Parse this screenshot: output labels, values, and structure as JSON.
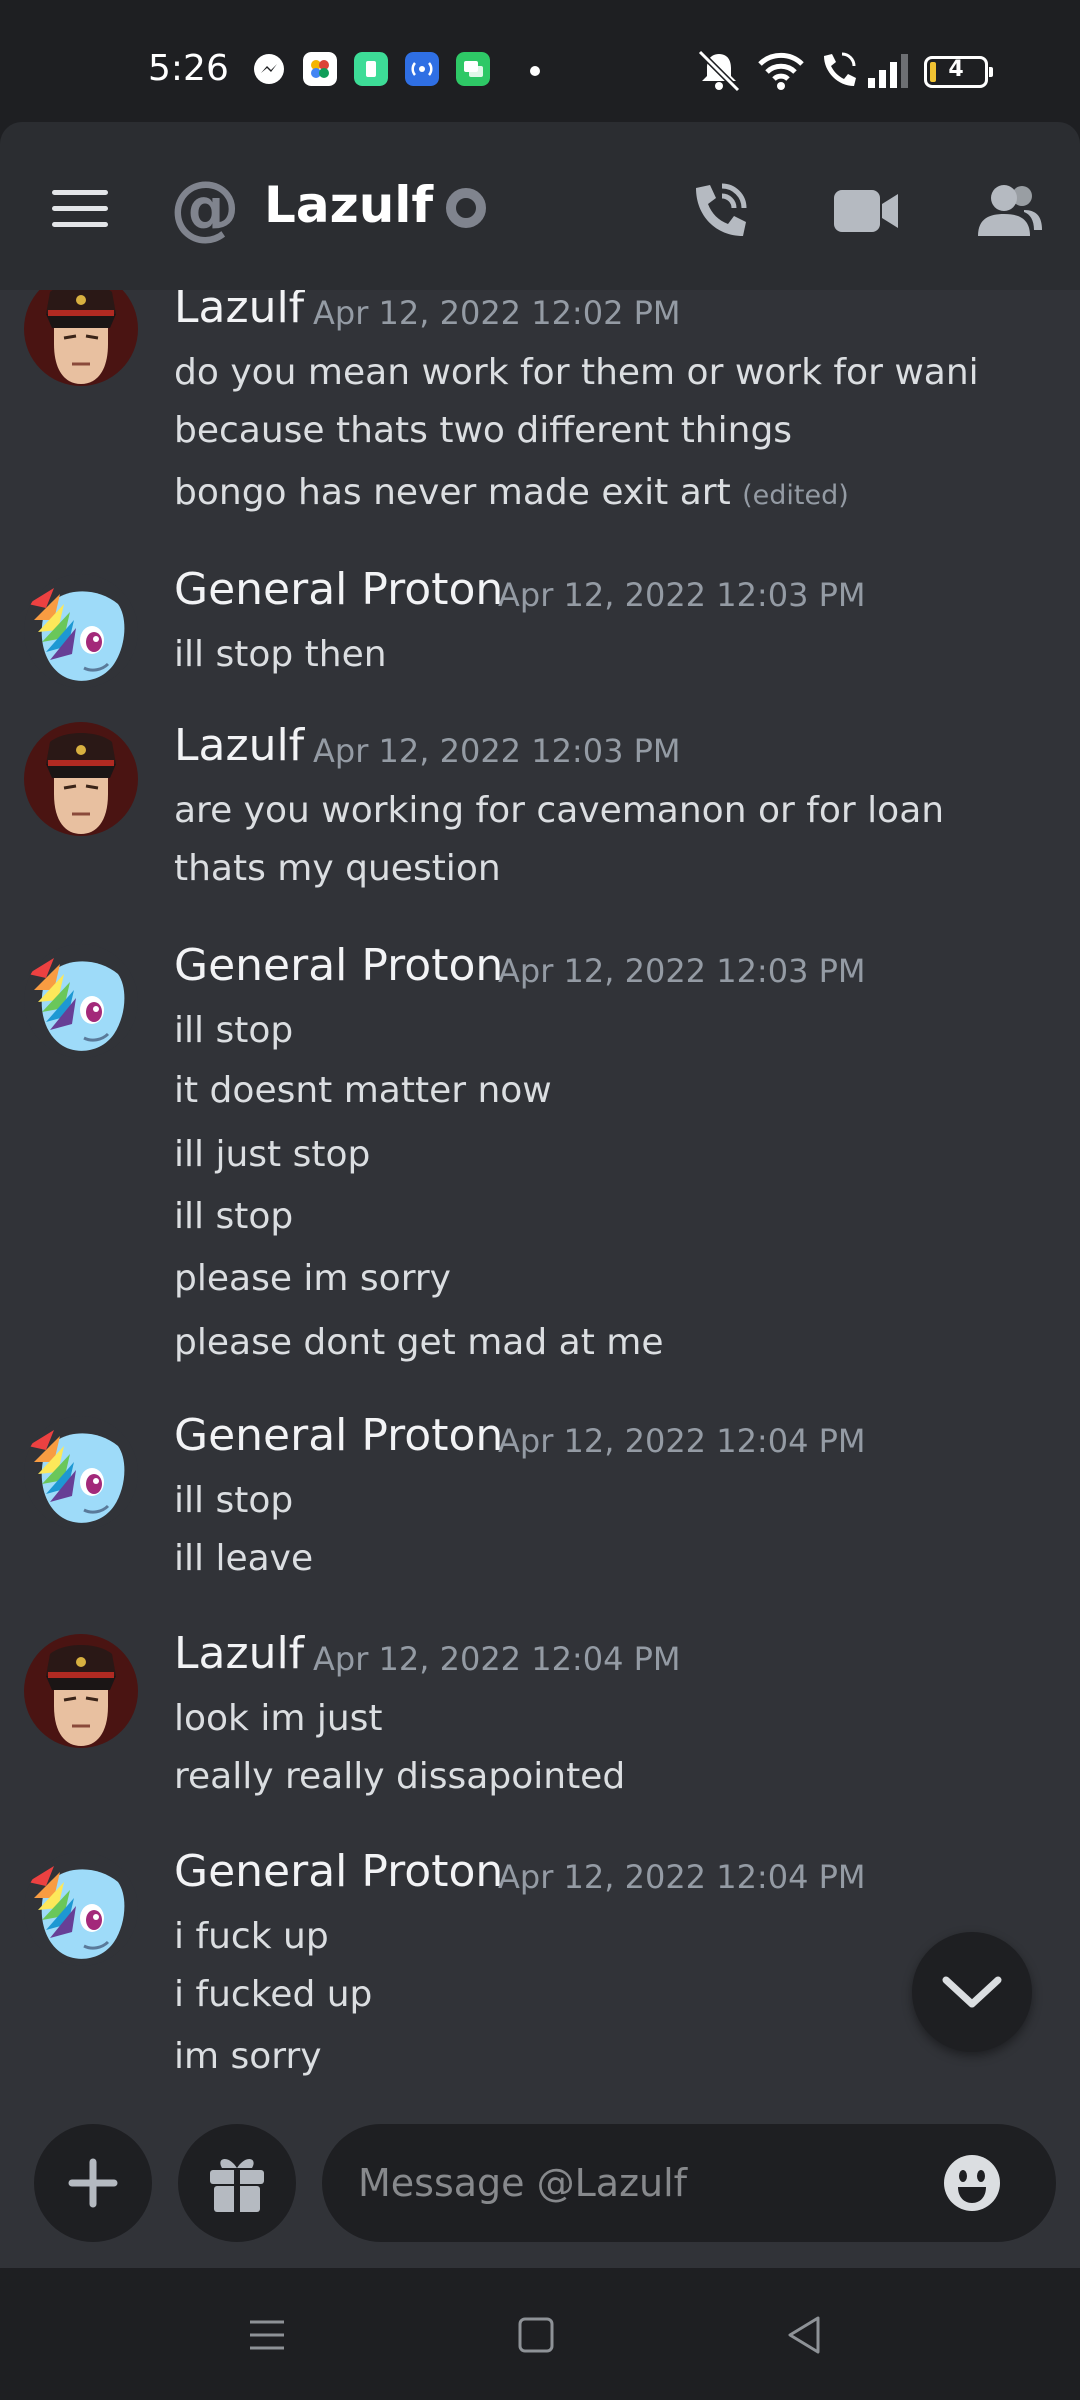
{
  "status_bar": {
    "time": "5:26",
    "battery": "4",
    "app_icons": [
      {
        "name": "messenger-icon",
        "color": "#ffffff"
      },
      {
        "name": "photos-icon",
        "color": "#ffffff"
      },
      {
        "name": "app-green-icon",
        "color": "#3ddc97"
      },
      {
        "name": "broadcast-icon",
        "color": "#2f6fe4"
      },
      {
        "name": "chat-green-icon",
        "color": "#2ec866"
      }
    ]
  },
  "header": {
    "title": "Lazulf"
  },
  "messages": [
    {
      "author": "Lazulf",
      "timestamp": "Apr 12, 2022 12:02 PM",
      "avatar": "officer-avatar",
      "lines": [
        "do you mean work for them or work for wani",
        "because thats two different things",
        "bongo has never made exit art"
      ],
      "edited_label": "(edited)"
    },
    {
      "author": "General Proton",
      "timestamp": "Apr 12, 2022 12:03 PM",
      "avatar": "pony-avatar",
      "lines": [
        "ill stop then"
      ]
    },
    {
      "author": "Lazulf",
      "timestamp": "Apr 12, 2022 12:03 PM",
      "avatar": "officer-avatar",
      "lines": [
        "are you working for cavemanon or for loan",
        "thats my question"
      ]
    },
    {
      "author": "General Proton",
      "timestamp": "Apr 12, 2022 12:03 PM",
      "avatar": "pony-avatar",
      "lines": [
        "ill stop",
        "it doesnt matter now",
        "ill just stop",
        "ill stop",
        "please im sorry",
        "please dont get mad at me"
      ]
    },
    {
      "author": "General Proton",
      "timestamp": "Apr 12, 2022 12:04 PM",
      "avatar": "pony-avatar",
      "lines": [
        "ill stop",
        "ill leave"
      ]
    },
    {
      "author": "Lazulf",
      "timestamp": "Apr 12, 2022 12:04 PM",
      "avatar": "officer-avatar",
      "lines": [
        "look im just",
        "really really dissapointed"
      ]
    },
    {
      "author": "General Proton",
      "timestamp": "Apr 12, 2022 12:04 PM",
      "avatar": "pony-avatar",
      "lines": [
        "i fuck up",
        "i fucked up",
        "im sorry"
      ]
    }
  ],
  "composer": {
    "placeholder": "Message @Lazulf"
  },
  "colors": {
    "background": "#313338",
    "header": "#2b2d31",
    "timestamp": "#949ba4"
  }
}
